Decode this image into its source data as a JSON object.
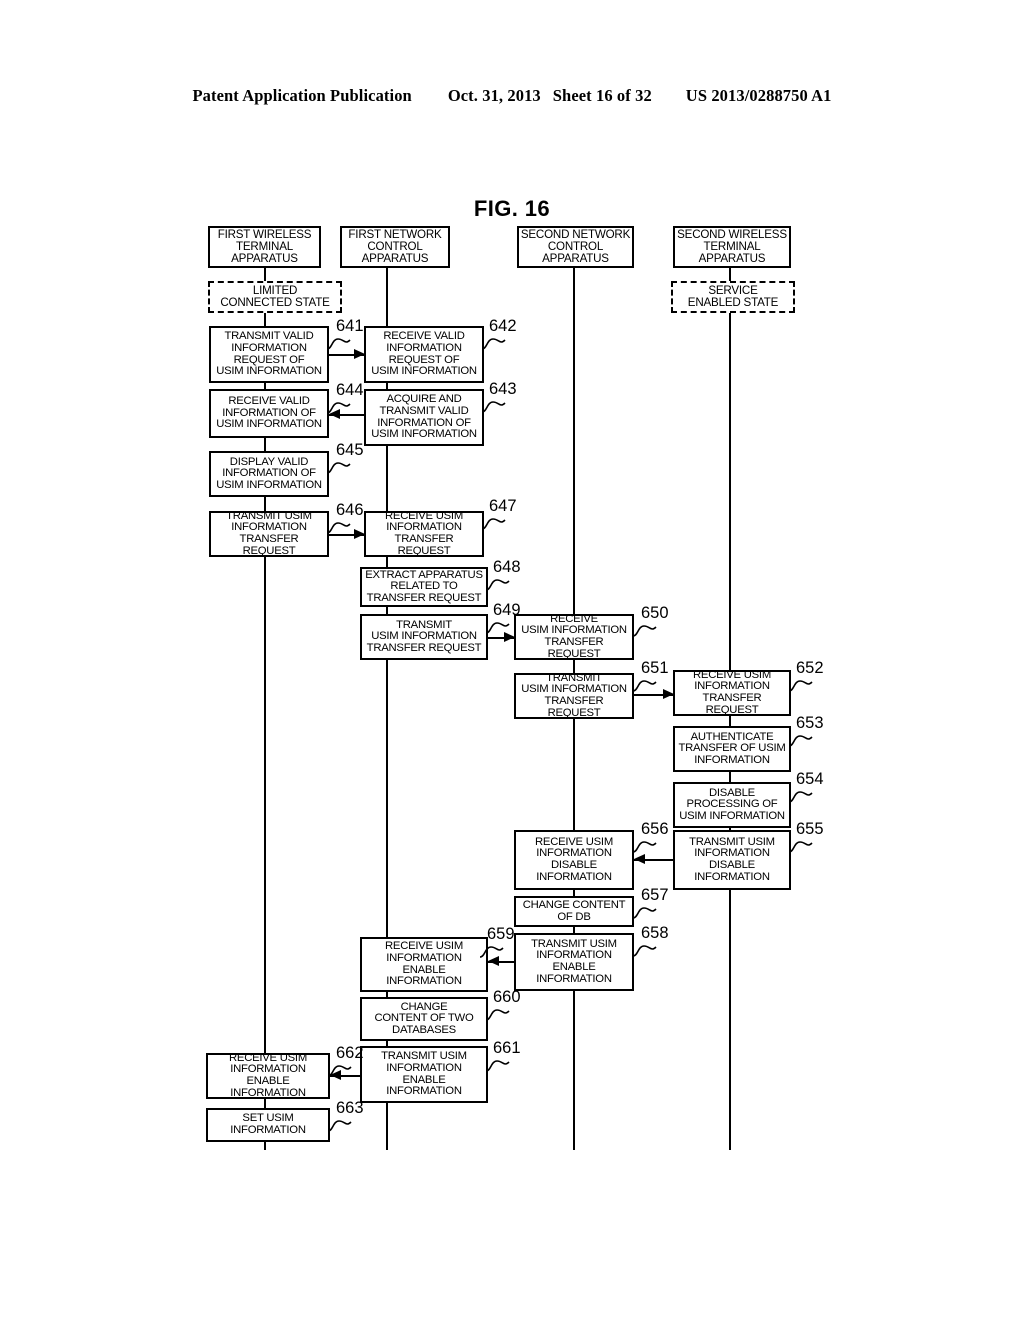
{
  "header": {
    "publication": "Patent Application Publication",
    "date": "Oct. 31, 2013",
    "sheet": "Sheet 16 of 32",
    "patent_number": "US 2013/0288750 A1"
  },
  "figure": {
    "title": "FIG. 16",
    "type": "sequence-flow-diagram",
    "lanes": [
      {
        "id": "lane1",
        "label": "FIRST WIRELESS\nTERMINAL\nAPPARATUS",
        "state": "LIMITED\nCONNECTED STATE"
      },
      {
        "id": "lane2",
        "label": "FIRST NETWORK\nCONTROL\nAPPARATUS",
        "state": null
      },
      {
        "id": "lane3",
        "label": "SECOND NETWORK\nCONTROL\nAPPARATUS",
        "state": null
      },
      {
        "id": "lane4",
        "label": "SECOND WIRELESS\nTERMINAL\nAPPARATUS",
        "state": "SERVICE\nENABLED STATE"
      }
    ],
    "lane_headers": {
      "l1": "FIRST WIRELESS TERMINAL APPARATUS",
      "l2": "FIRST NETWORK CONTROL APPARATUS",
      "l3": "SECOND NETWORK CONTROL APPARATUS",
      "l4": "SECOND WIRELESS TERMINAL APPARATUS"
    },
    "lane_header_lines": {
      "l1": [
        "FIRST WIRELESS",
        "TERMINAL",
        "APPARATUS"
      ],
      "l2": [
        "FIRST NETWORK",
        "CONTROL",
        "APPARATUS"
      ],
      "l3": [
        "SECOND NETWORK",
        "CONTROL",
        "APPARATUS"
      ],
      "l4": [
        "SECOND WIRELESS",
        "TERMINAL",
        "APPARATUS"
      ]
    },
    "states": {
      "s1": [
        "LIMITED",
        "CONNECTED STATE"
      ],
      "s4": [
        "SERVICE",
        "ENABLED STATE"
      ]
    },
    "steps": [
      {
        "ref": "641",
        "lane": 1,
        "lines": [
          "TRANSMIT VALID",
          "INFORMATION",
          "REQUEST OF",
          "USIM INFORMATION"
        ]
      },
      {
        "ref": "642",
        "lane": 2,
        "lines": [
          "RECEIVE VALID",
          "INFORMATION",
          "REQUEST OF",
          "USIM INFORMATION"
        ]
      },
      {
        "ref": "643",
        "lane": 2,
        "lines": [
          "ACQUIRE AND",
          "TRANSMIT VALID",
          "INFORMATION OF",
          "USIM INFORMATION"
        ]
      },
      {
        "ref": "644",
        "lane": 1,
        "lines": [
          "RECEIVE VALID",
          "INFORMATION OF",
          "USIM INFORMATION"
        ]
      },
      {
        "ref": "645",
        "lane": 1,
        "lines": [
          "DISPLAY VALID",
          "INFORMATION OF",
          "USIM INFORMATION"
        ]
      },
      {
        "ref": "646",
        "lane": 1,
        "lines": [
          "TRANSMIT USIM",
          "INFORMATION",
          "TRANSFER REQUEST"
        ]
      },
      {
        "ref": "647",
        "lane": 2,
        "lines": [
          "RECEIVE USIM",
          "INFORMATION",
          "TRANSFER REQUEST"
        ]
      },
      {
        "ref": "648",
        "lane": 2,
        "lines": [
          "EXTRACT APPARATUS",
          "RELATED TO",
          "TRANSFER REQUEST"
        ]
      },
      {
        "ref": "649",
        "lane": 2,
        "lines": [
          "TRANSMIT",
          "USIM INFORMATION",
          "TRANSFER REQUEST"
        ]
      },
      {
        "ref": "650",
        "lane": 3,
        "lines": [
          "RECEIVE",
          "USIM INFORMATION",
          "TRANSFER REQUEST"
        ]
      },
      {
        "ref": "651",
        "lane": 3,
        "lines": [
          "TRANSMIT",
          "USIM INFORMATION",
          "TRANSFER REQUEST"
        ]
      },
      {
        "ref": "652",
        "lane": 4,
        "lines": [
          "RECEIVE USIM",
          "INFORMATION",
          "TRANSFER REQUEST"
        ]
      },
      {
        "ref": "653",
        "lane": 4,
        "lines": [
          "AUTHENTICATE",
          "TRANSFER OF USIM",
          "INFORMATION"
        ]
      },
      {
        "ref": "654",
        "lane": 4,
        "lines": [
          "DISABLE",
          "PROCESSING OF",
          "USIM INFORMATION"
        ]
      },
      {
        "ref": "655",
        "lane": 4,
        "lines": [
          "TRANSMIT USIM",
          "INFORMATION",
          "DISABLE",
          "INFORMATION"
        ]
      },
      {
        "ref": "656",
        "lane": 3,
        "lines": [
          "RECEIVE USIM",
          "INFORMATION",
          "DISABLE",
          "INFORMATION"
        ]
      },
      {
        "ref": "657",
        "lane": 3,
        "lines": [
          "CHANGE CONTENT",
          "OF DB"
        ]
      },
      {
        "ref": "658",
        "lane": 3,
        "lines": [
          "TRANSMIT USIM",
          "INFORMATION",
          "ENABLE",
          "INFORMATION"
        ]
      },
      {
        "ref": "659",
        "lane": 2,
        "lines": [
          "RECEIVE USIM",
          "INFORMATION",
          "ENABLE",
          "INFORMATION"
        ]
      },
      {
        "ref": "660",
        "lane": 2,
        "lines": [
          "CHANGE",
          "CONTENT OF TWO",
          "DATABASES"
        ]
      },
      {
        "ref": "661",
        "lane": 2,
        "lines": [
          "TRANSMIT USIM",
          "INFORMATION",
          "ENABLE",
          "INFORMATION"
        ]
      },
      {
        "ref": "662",
        "lane": 1,
        "lines": [
          "RECEIVE USIM",
          "INFORMATION ENABLE",
          "INFORMATION"
        ]
      },
      {
        "ref": "663",
        "lane": 1,
        "lines": [
          "SET USIM",
          "INFORMATION"
        ]
      }
    ],
    "refs": {
      "r641": "641",
      "r642": "642",
      "r643": "643",
      "r644": "644",
      "r645": "645",
      "r646": "646",
      "r647": "647",
      "r648": "648",
      "r649": "649",
      "r650": "650",
      "r651": "651",
      "r652": "652",
      "r653": "653",
      "r654": "654",
      "r655": "655",
      "r656": "656",
      "r657": "657",
      "r658": "658",
      "r659": "659",
      "r660": "660",
      "r661": "661",
      "r662": "662",
      "r663": "663"
    },
    "box_text": {
      "b641": "TRANSMIT VALID\nINFORMATION\nREQUEST OF\nUSIM INFORMATION",
      "b642": "RECEIVE VALID\nINFORMATION\nREQUEST OF\nUSIM INFORMATION",
      "b643": "ACQUIRE AND\nTRANSMIT VALID\nINFORMATION OF\nUSIM INFORMATION",
      "b644": "RECEIVE VALID\nINFORMATION OF\nUSIM INFORMATION",
      "b645": "DISPLAY VALID\nINFORMATION OF\nUSIM INFORMATION",
      "b646": "TRANSMIT USIM\nINFORMATION\nTRANSFER REQUEST",
      "b647": "RECEIVE USIM\nINFORMATION\nTRANSFER REQUEST",
      "b648": "EXTRACT APPARATUS\nRELATED TO\nTRANSFER REQUEST",
      "b649": "TRANSMIT\nUSIM INFORMATION\nTRANSFER REQUEST",
      "b650": "RECEIVE\nUSIM INFORMATION\nTRANSFER REQUEST",
      "b651": "TRANSMIT\nUSIM INFORMATION\nTRANSFER REQUEST",
      "b652": "RECEIVE USIM\nINFORMATION\nTRANSFER REQUEST",
      "b653": "AUTHENTICATE\nTRANSFER OF USIM\nINFORMATION",
      "b654": "DISABLE\nPROCESSING OF\nUSIM INFORMATION",
      "b655": "TRANSMIT USIM\nINFORMATION\nDISABLE\nINFORMATION",
      "b656": "RECEIVE USIM\nINFORMATION\nDISABLE\nINFORMATION",
      "b657": "CHANGE CONTENT\nOF DB",
      "b658": "TRANSMIT USIM\nINFORMATION\nENABLE\nINFORMATION",
      "b659": "RECEIVE USIM\nINFORMATION\nENABLE\nINFORMATION",
      "b660": "CHANGE\nCONTENT OF TWO\nDATABASES",
      "b661": "TRANSMIT USIM\nINFORMATION\nENABLE\nINFORMATION",
      "b662": "RECEIVE USIM\nINFORMATION ENABLE\nINFORMATION",
      "b663": "SET USIM\nINFORMATION"
    }
  }
}
